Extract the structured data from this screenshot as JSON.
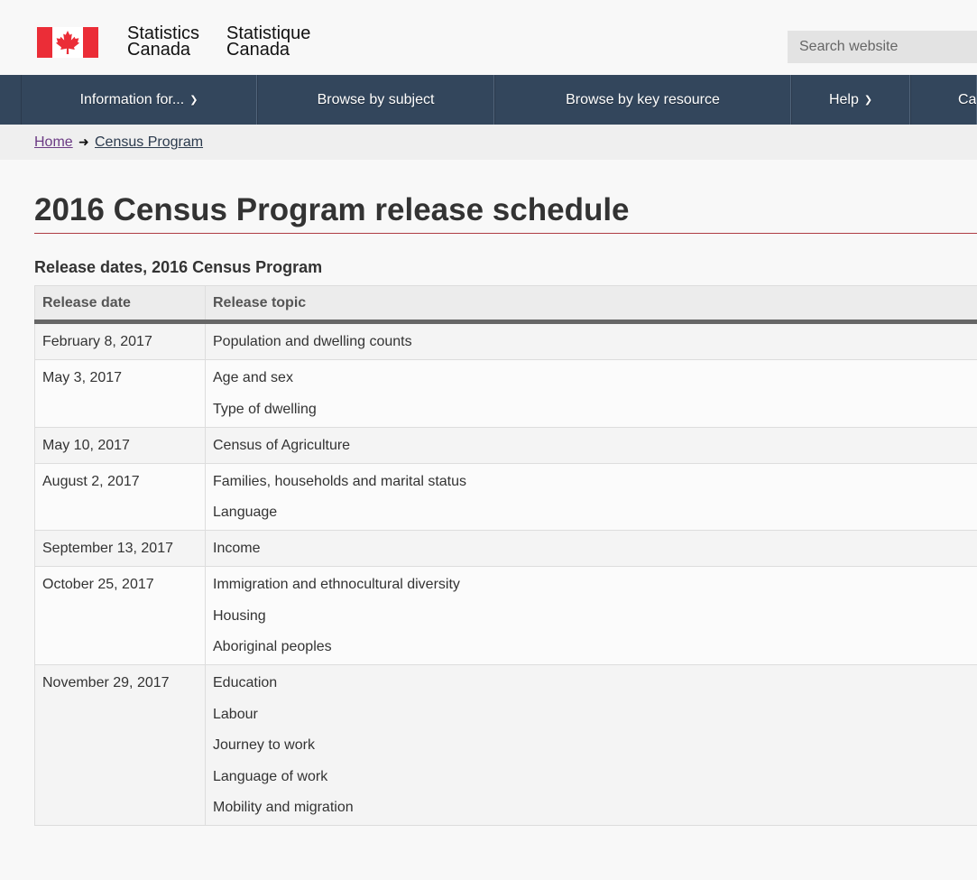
{
  "header": {
    "signature_en": [
      "Statistics",
      "Canada"
    ],
    "signature_fr": [
      "Statistique",
      "Canada"
    ],
    "search_placeholder": "Search website"
  },
  "nav": {
    "items": [
      {
        "label": "Information for...",
        "has_menu": true
      },
      {
        "label": "Browse by subject",
        "has_menu": false
      },
      {
        "label": "Browse by key resource",
        "has_menu": false
      },
      {
        "label": "Help",
        "has_menu": true
      },
      {
        "label": "Ca",
        "has_menu": false
      }
    ]
  },
  "breadcrumb": {
    "home": "Home",
    "census": "Census Program"
  },
  "page": {
    "title": "2016 Census Program release schedule",
    "table_caption": "Release dates, 2016 Census Program"
  },
  "table": {
    "headers": [
      "Release date",
      "Release topic"
    ],
    "rows": [
      {
        "date": "February 8, 2017",
        "topics": [
          "Population and dwelling counts"
        ]
      },
      {
        "date": "May 3, 2017",
        "topics": [
          "Age and sex",
          "Type of dwelling"
        ]
      },
      {
        "date": "May 10, 2017",
        "topics": [
          "Census of Agriculture"
        ]
      },
      {
        "date": "August 2, 2017",
        "topics": [
          "Families, households and marital status",
          "Language"
        ]
      },
      {
        "date": "September 13, 2017",
        "topics": [
          "Income"
        ]
      },
      {
        "date": "October 25, 2017",
        "topics": [
          "Immigration and ethnocultural diversity",
          "Housing",
          "Aboriginal peoples"
        ]
      },
      {
        "date": "November 29, 2017",
        "topics": [
          "Education",
          "Labour",
          "Journey to work",
          "Language of work",
          "Mobility and migration"
        ]
      }
    ]
  },
  "colors": {
    "nav_bg": "#33465c",
    "flag_red": "#eb2d37",
    "title_rule": "#af3c43",
    "visited_link": "#6b3a84"
  }
}
